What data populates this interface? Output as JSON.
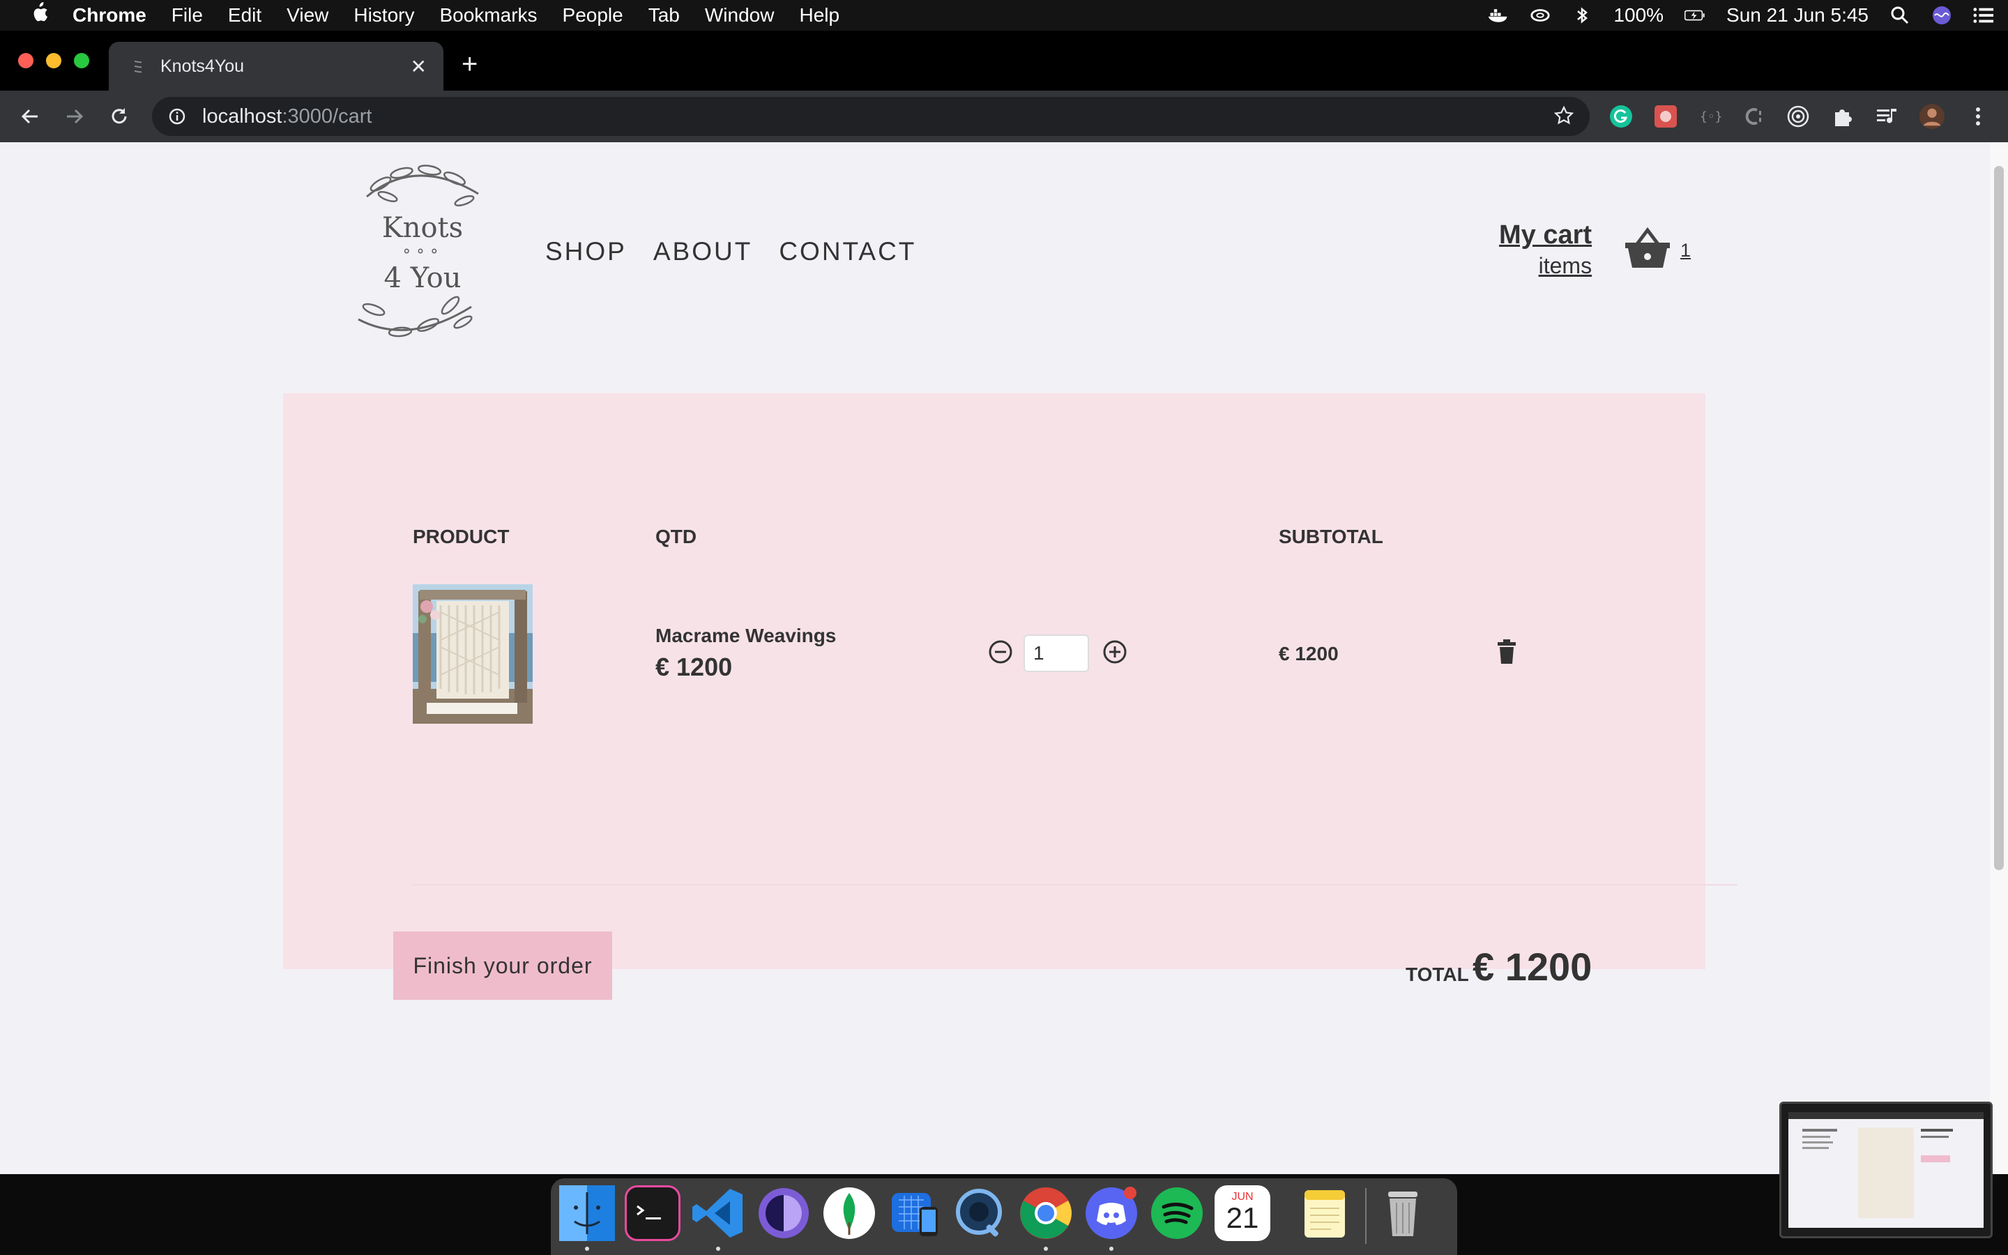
{
  "menubar": {
    "app": "Chrome",
    "items": [
      "File",
      "Edit",
      "View",
      "History",
      "Bookmarks",
      "People",
      "Tab",
      "Window",
      "Help"
    ],
    "battery": "100%",
    "datetime": "Sun 21 Jun  5:45"
  },
  "browser": {
    "tab_title": "Knots4You",
    "url_host": "localhost",
    "url_path": ":3000/cart"
  },
  "site": {
    "logo_line1": "Knots",
    "logo_dots": "∘∘∘",
    "logo_line2": "4 You",
    "nav": [
      "SHOP",
      "ABOUT",
      "CONTACT"
    ],
    "cart_label": "My cart",
    "cart_items_label": "items",
    "cart_count": "1"
  },
  "cart": {
    "headers": {
      "product": "PRODUCT",
      "qty": "QTD",
      "subtotal": "SUBTOTAL"
    },
    "item": {
      "name": "Macrame Weavings",
      "price": "€ 1200",
      "quantity": "1",
      "subtotal": "€ 1200"
    },
    "finish_label": "Finish your order",
    "total_label": "TOTAL",
    "total_value": "€ 1200"
  },
  "dock": {
    "calendar_month": "JUN",
    "calendar_day": "21"
  },
  "colors": {
    "panel_bg": "#f7e2e8",
    "button_bg": "#efbccc",
    "page_bg": "#f2f1f6",
    "text": "#333333"
  }
}
